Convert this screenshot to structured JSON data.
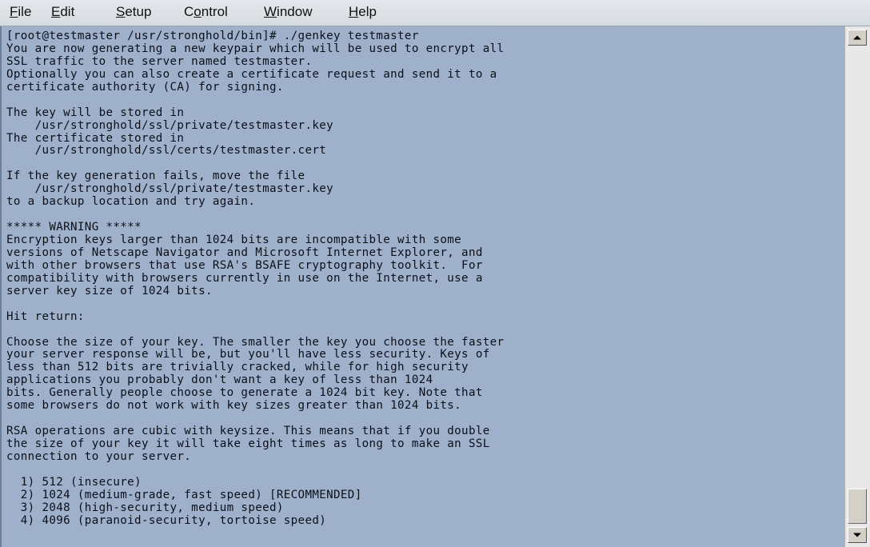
{
  "menu": [
    {
      "label": "File",
      "accel": "F",
      "rest": "ile"
    },
    {
      "label": "Edit",
      "accel": "E",
      "rest": "dit"
    },
    {
      "label": "Setup",
      "accel": "S",
      "rest": "etup"
    },
    {
      "label": "Control",
      "pre": "C",
      "accel": "o",
      "rest": "ntrol"
    },
    {
      "label": "Window",
      "accel": "W",
      "rest": "indow"
    },
    {
      "label": "Help",
      "accel": "H",
      "rest": "elp"
    }
  ],
  "terminal": {
    "lines": [
      "[root@testmaster /usr/stronghold/bin]# ./genkey testmaster",
      "You are now generating a new keypair which will be used to encrypt all",
      "SSL traffic to the server named testmaster.",
      "Optionally you can also create a certificate request and send it to a",
      "certificate authority (CA) for signing.",
      "",
      "The key will be stored in",
      "    /usr/stronghold/ssl/private/testmaster.key",
      "The certificate stored in",
      "    /usr/stronghold/ssl/certs/testmaster.cert",
      "",
      "If the key generation fails, move the file",
      "    /usr/stronghold/ssl/private/testmaster.key",
      "to a backup location and try again.",
      "",
      "***** WARNING *****",
      "Encryption keys larger than 1024 bits are incompatible with some",
      "versions of Netscape Navigator and Microsoft Internet Explorer, and",
      "with other browsers that use RSA's BSAFE cryptography toolkit.  For",
      "compatibility with browsers currently in use on the Internet, use a",
      "server key size of 1024 bits.",
      "",
      "Hit return:",
      "",
      "Choose the size of your key. The smaller the key you choose the faster",
      "your server response will be, but you'll have less security. Keys of",
      "less than 512 bits are trivially cracked, while for high security",
      "applications you probably don't want a key of less than 1024",
      "bits. Generally people choose to generate a 1024 bit key. Note that",
      "some browsers do not work with key sizes greater than 1024 bits.",
      "",
      "RSA operations are cubic with keysize. This means that if you double",
      "the size of your key it will take eight times as long to make an SSL",
      "connection to your server.",
      "",
      "  1) 512 (insecure)",
      "  2) 1024 (medium-grade, fast speed) [RECOMMENDED]",
      "  3) 2048 (high-security, medium speed)",
      "  4) 4096 (paranoid-security, tortoise speed)"
    ]
  },
  "scrollbar": {
    "up_icon": "scroll-up-arrow-icon",
    "down_icon": "scroll-down-arrow-icon",
    "position_fraction": 0.96
  },
  "colors": {
    "terminal_background": "#9fb1ca",
    "terminal_text": "#0a0f1a",
    "menubar_background": "#dde1e6"
  }
}
